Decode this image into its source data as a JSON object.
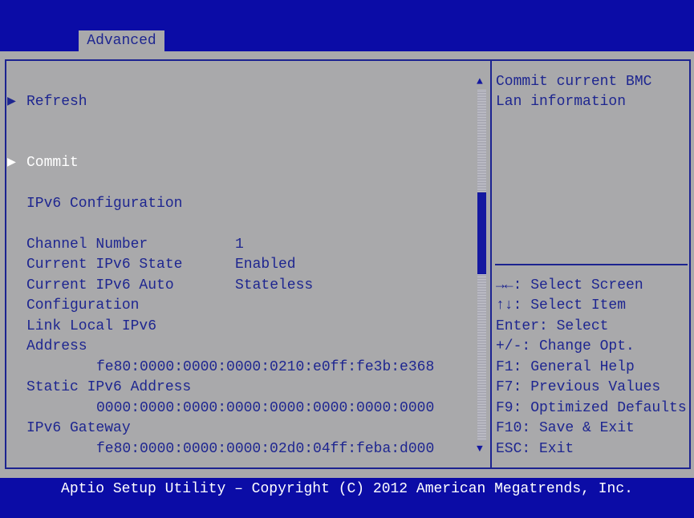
{
  "header": {
    "active_tab": "Advanced"
  },
  "main": {
    "items": [
      {
        "label": "Refresh",
        "type": "submenu"
      },
      {
        "label": "Commit",
        "type": "submenu",
        "selected": true
      }
    ],
    "section_title": "IPv6 Configuration",
    "channel_number": {
      "label": "Channel Number",
      "value": "1"
    },
    "ipv6_state": {
      "label": "Current IPv6 State",
      "value": "Enabled"
    },
    "ipv6_auto": {
      "label1": "Current IPv6 Auto",
      "label2": "Configuration",
      "value": "Stateless"
    },
    "link_local": {
      "label1": "Link Local IPv6",
      "label2": "Address",
      "value": "fe80:0000:0000:0000:0210:e0ff:fe3b:e368"
    },
    "static_addr": {
      "label": "Static IPv6 Address",
      "value": "0000:0000:0000:0000:0000:0000:0000:0000"
    },
    "gateway": {
      "label": "IPv6 Gateway",
      "value": "fe80:0000:0000:0000:02d0:04ff:feba:d000"
    }
  },
  "help": {
    "line1": "Commit current BMC",
    "line2": "Lan information"
  },
  "keys": [
    "→←: Select Screen",
    "↑↓: Select Item",
    "Enter: Select",
    "+/-: Change Opt.",
    "F1: General Help",
    "F7: Previous Values",
    "F9: Optimized Defaults",
    "F10: Save & Exit",
    "ESC: Exit"
  ],
  "footer": "Aptio Setup Utility – Copyright (C) 2012 American Megatrends, Inc.",
  "colors": {
    "blue": "#0b0ca6",
    "gray": "#a9a9ab",
    "text": "#1e2690"
  }
}
